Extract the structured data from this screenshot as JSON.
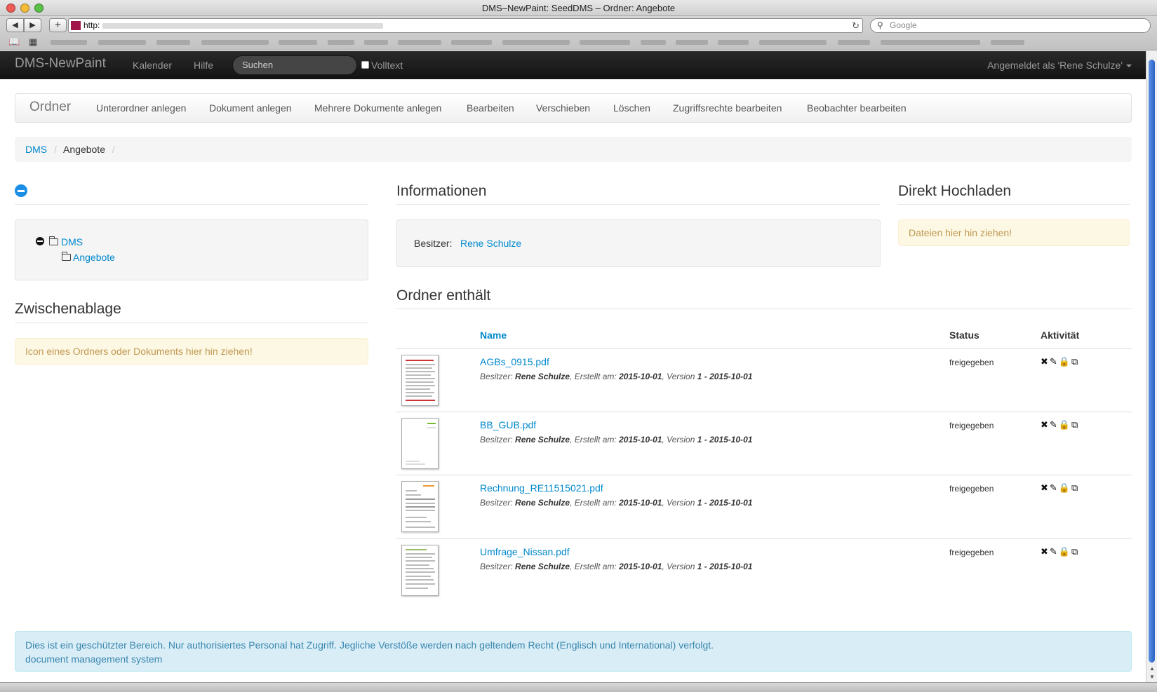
{
  "browser": {
    "window_title": "DMS–NewPaint: SeedDMS – Ordner: Angebote",
    "url_prefix": "http:",
    "search_placeholder": "Google"
  },
  "navbar": {
    "brand": "DMS-NewPaint",
    "links": [
      "Kalender",
      "Hilfe"
    ],
    "search_placeholder": "Suchen",
    "fulltext_label": "Volltext",
    "user_label": "Angemeldet als 'Rene Schulze'"
  },
  "subnav": {
    "title": "Ordner",
    "items": [
      "Unterordner anlegen",
      "Dokument anlegen",
      "Mehrere Dokumente anlegen",
      "Bearbeiten",
      "Verschieben",
      "Löschen",
      "Zugriffsrechte bearbeiten",
      "Beobachter bearbeiten"
    ]
  },
  "breadcrumb": {
    "root": "DMS",
    "current": "Angebote",
    "separator": "/"
  },
  "tree": {
    "root": "DMS",
    "child": "Angebote"
  },
  "clipboard": {
    "title": "Zwischenablage",
    "hint": "Icon eines Ordners oder Dokuments hier hin ziehen!"
  },
  "info": {
    "title": "Informationen",
    "owner_label": "Besitzer:",
    "owner": "Rene Schulze"
  },
  "upload": {
    "title": "Direkt Hochladen",
    "hint": "Dateien hier hin ziehen!"
  },
  "contents": {
    "title": "Ordner enthält",
    "columns": [
      "Name",
      "Status",
      "Aktivität"
    ],
    "documents": [
      {
        "name": "AGBs_0915.pdf",
        "owner_label": "Besitzer:",
        "owner": "Rene Schulze",
        "created_label": "Erstellt am:",
        "created": "2015-10-01",
        "version_label": "Version",
        "version": "1 - 2015-10-01",
        "status": "freigegeben"
      },
      {
        "name": "BB_GUB.pdf",
        "owner_label": "Besitzer:",
        "owner": "Rene Schulze",
        "created_label": "Erstellt am:",
        "created": "2015-10-01",
        "version_label": "Version",
        "version": "1 - 2015-10-01",
        "status": "freigegeben"
      },
      {
        "name": "Rechnung_RE11515021.pdf",
        "owner_label": "Besitzer:",
        "owner": "Rene Schulze",
        "created_label": "Erstellt am:",
        "created": "2015-10-01",
        "version_label": "Version",
        "version": "1 - 2015-10-01",
        "status": "freigegeben"
      },
      {
        "name": "Umfrage_Nissan.pdf",
        "owner_label": "Besitzer:",
        "owner": "Rene Schulze",
        "created_label": "Erstellt am:",
        "created": "2015-10-01",
        "version_label": "Version",
        "version": "1 - 2015-10-01",
        "status": "freigegeben"
      }
    ],
    "action_icons": [
      "delete-icon",
      "edit-icon",
      "lock-icon",
      "copy-icon"
    ]
  },
  "footer": {
    "line1": "Dies ist ein geschützter Bereich. Nur authorisiertes Personal hat Zugriff. Jegliche Verstöße werden nach geltendem Recht (Englisch und International) verfolgt.",
    "line2": "document management system"
  },
  "colors": {
    "link": "#0088cc",
    "navbar_bg": "#1b1b1b",
    "warning_bg": "#fcf8e3",
    "warning_text": "#c09853",
    "info_bg": "#d9edf7",
    "info_text": "#3a87ad"
  }
}
